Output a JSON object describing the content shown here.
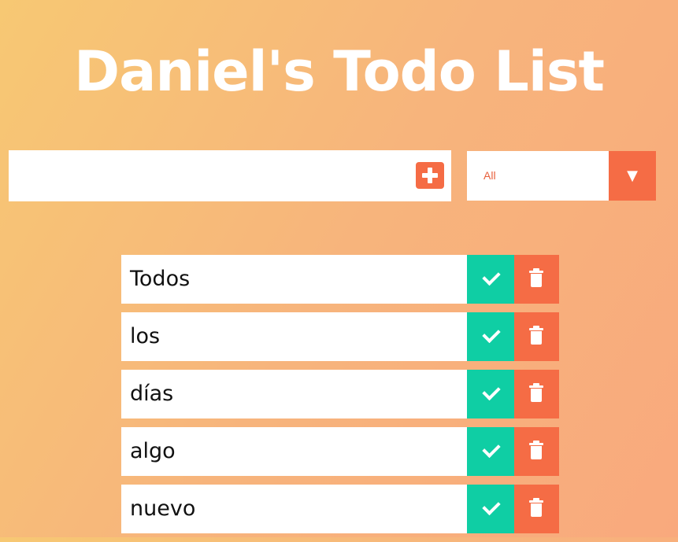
{
  "header": {
    "title": "Daniel's Todo List"
  },
  "add_form": {
    "input_value": "",
    "add_icon": "plus-square-icon"
  },
  "filter": {
    "selected": "All",
    "arrow_glyph": "▼"
  },
  "todos": [
    {
      "text": "Todos",
      "complete_icon": "check-icon",
      "delete_icon": "trash-icon"
    },
    {
      "text": "los",
      "complete_icon": "check-icon",
      "delete_icon": "trash-icon"
    },
    {
      "text": "días",
      "complete_icon": "check-icon",
      "delete_icon": "trash-icon"
    },
    {
      "text": "algo",
      "complete_icon": "check-icon",
      "delete_icon": "trash-icon"
    },
    {
      "text": "nuevo",
      "complete_icon": "check-icon",
      "delete_icon": "trash-icon"
    }
  ],
  "colors": {
    "accent_orange": "#f56c45",
    "complete_green": "#0fcea4",
    "background_start": "#f7c873",
    "background_end": "#f9a97d",
    "title_color": "#ffffff"
  }
}
